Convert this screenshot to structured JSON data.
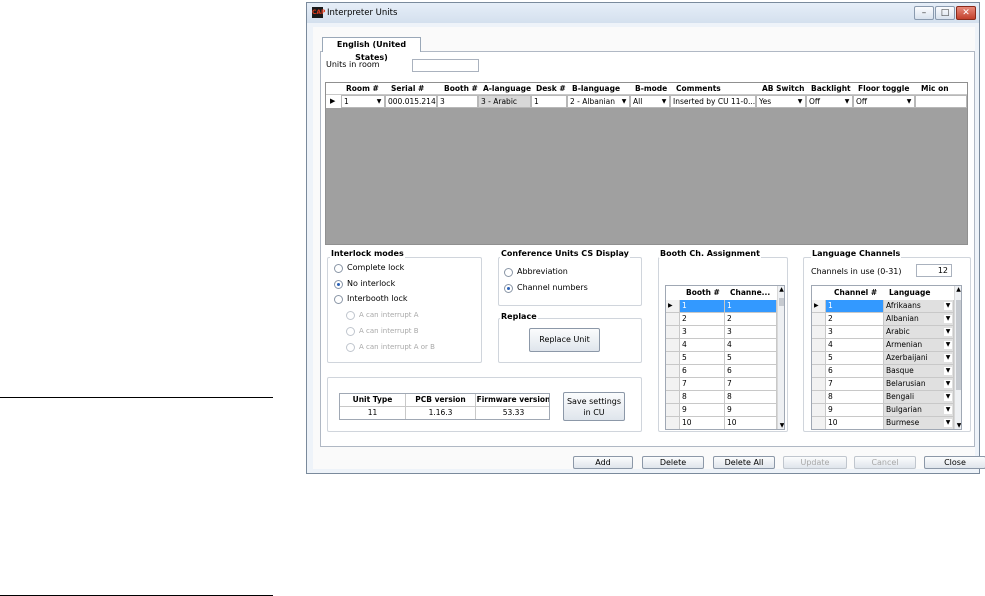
{
  "window": {
    "title": "Interpreter Units",
    "app_icon": "CAP",
    "minimize": "–",
    "maximize": "□",
    "close": "✕"
  },
  "tab": {
    "label": "English (United States)"
  },
  "units_in_room": {
    "label": "Units in room",
    "value": ""
  },
  "unit_grid": {
    "columns": [
      "Room #",
      "Serial #",
      "Booth #",
      "A-language",
      "Desk #",
      "B-language",
      "B-mode",
      "Comments",
      "AB Switch",
      "Backlight",
      "Floor toggle",
      "Mic on"
    ],
    "row": {
      "room": "1",
      "serial": "000.015.214",
      "booth": "3",
      "a_language": "3 - Arabic",
      "desk": "1",
      "b_language": "2 - Albanian",
      "b_mode": "All",
      "comments": "Inserted by CU 11-0...",
      "ab_switch": "Yes",
      "backlight": "Off",
      "floor_toggle": "Off",
      "mic_on": ""
    }
  },
  "interlock": {
    "title": "Interlock modes",
    "options": [
      "Complete lock",
      "No interlock",
      "Interbooth lock"
    ],
    "selected": "No interlock",
    "sub_options": [
      "A can interrupt A",
      "A can interrupt B",
      "A can interrupt A or B"
    ]
  },
  "cs_display": {
    "title": "Conference Units CS Display",
    "options": [
      "Abbreviation",
      "Channel numbers"
    ],
    "selected": "Channel numbers"
  },
  "replace": {
    "title": "Replace",
    "button": "Replace Unit"
  },
  "unit_info": {
    "headers": [
      "Unit Type",
      "PCB version",
      "Firmware version"
    ],
    "values": [
      "11",
      "1.16.3",
      "53.33"
    ],
    "save_button": "Save settings in CU"
  },
  "booth_assignment": {
    "title": "Booth Ch. Assignment",
    "headers": [
      "Booth #",
      "Channe..."
    ],
    "rows": [
      [
        "1",
        "1"
      ],
      [
        "2",
        "2"
      ],
      [
        "3",
        "3"
      ],
      [
        "4",
        "4"
      ],
      [
        "5",
        "5"
      ],
      [
        "6",
        "6"
      ],
      [
        "7",
        "7"
      ],
      [
        "8",
        "8"
      ],
      [
        "9",
        "9"
      ],
      [
        "10",
        "10"
      ]
    ]
  },
  "language_channels": {
    "title": "Language Channels",
    "in_use_label": "Channels in use (0-31)",
    "in_use_value": "12",
    "headers": [
      "Channel #",
      "Language"
    ],
    "rows": [
      [
        "1",
        "Afrikaans"
      ],
      [
        "2",
        "Albanian"
      ],
      [
        "3",
        "Arabic"
      ],
      [
        "4",
        "Armenian"
      ],
      [
        "5",
        "Azerbaijani"
      ],
      [
        "6",
        "Basque"
      ],
      [
        "7",
        "Belarusian"
      ],
      [
        "8",
        "Bengali"
      ],
      [
        "9",
        "Bulgarian"
      ],
      [
        "10",
        "Burmese"
      ]
    ]
  },
  "footer": {
    "add": "Add",
    "delete": "Delete",
    "delete_all": "Delete All",
    "update": "Update",
    "cancel": "Cancel",
    "close": "Close"
  },
  "colors": {
    "selection": "#3399ff",
    "grid_background": "#a0a0a0",
    "window_frame": "#7a8a9c",
    "close_button": "#c2402c"
  }
}
